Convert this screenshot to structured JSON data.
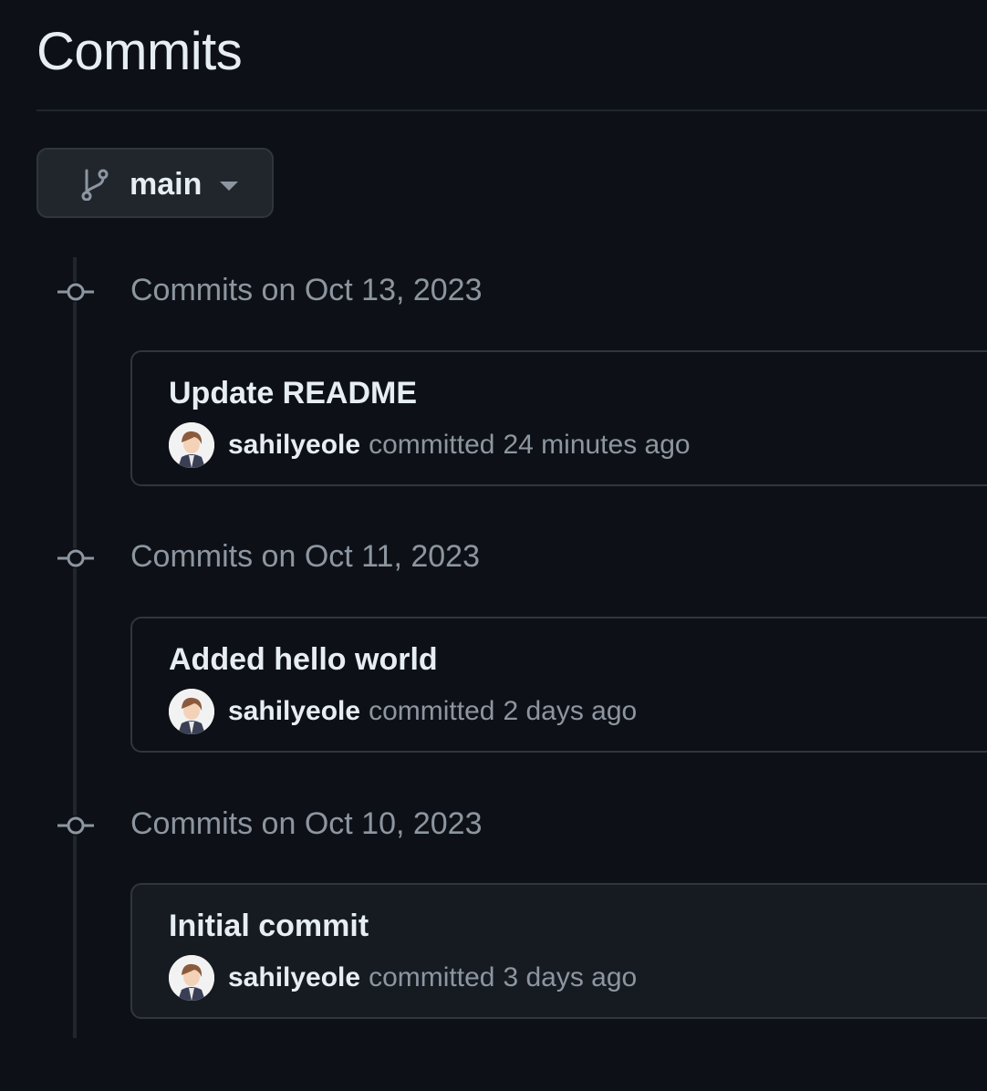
{
  "page": {
    "title": "Commits"
  },
  "branch": {
    "name": "main",
    "icon": "git-branch-icon"
  },
  "groups": [
    {
      "date_label": "Commits on Oct 13, 2023",
      "commits": [
        {
          "message": "Update README",
          "author": "sahilyeole",
          "action": "committed",
          "time_ago": "24 minutes ago"
        }
      ]
    },
    {
      "date_label": "Commits on Oct 11, 2023",
      "commits": [
        {
          "message": "Added hello world",
          "author": "sahilyeole",
          "action": "committed",
          "time_ago": "2 days ago"
        }
      ]
    },
    {
      "date_label": "Commits on Oct 10, 2023",
      "commits": [
        {
          "message": "Initial commit",
          "author": "sahilyeole",
          "action": "committed",
          "time_ago": "3 days ago"
        }
      ]
    }
  ],
  "colors": {
    "background": "#0d1117",
    "text_primary": "#e6edf3",
    "text_muted": "#8d96a0",
    "border": "#30363d",
    "button_bg": "#21262d"
  }
}
